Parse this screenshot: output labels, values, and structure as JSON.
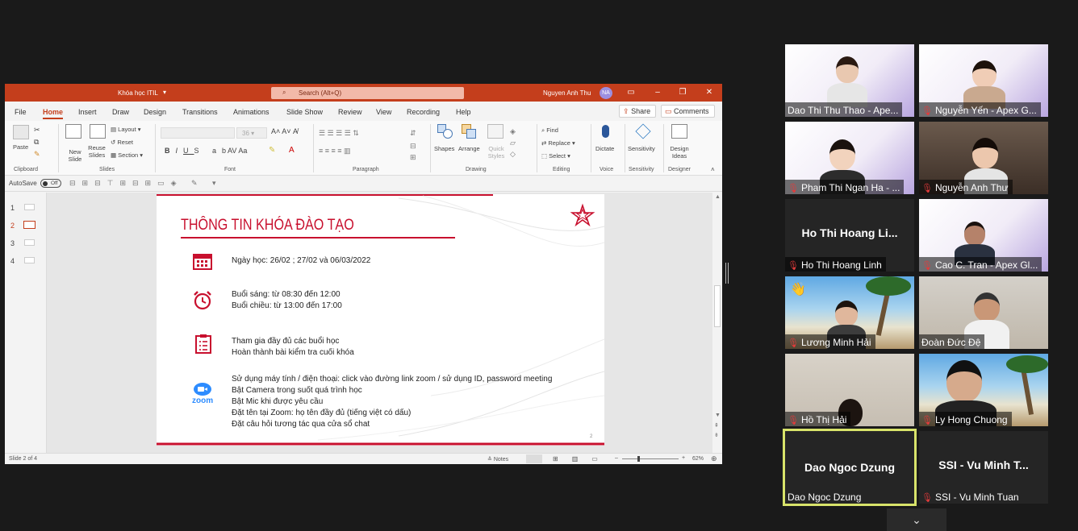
{
  "ppt": {
    "doc_title": "Khóa học ITIL",
    "search_placeholder": "Search (Alt+Q)",
    "user_name": "Nguyen Anh Thu",
    "user_initials": "NA",
    "menu": [
      "File",
      "Home",
      "Insert",
      "Draw",
      "Design",
      "Transitions",
      "Animations",
      "Slide Show",
      "Review",
      "View",
      "Recording",
      "Help"
    ],
    "share_label": "Share",
    "comments_label": "Comments",
    "ribbon": {
      "paste": "Paste",
      "clipboard": "Clipboard",
      "new_slide": "New Slide",
      "reuse_slides": "Reuse Slides",
      "layout": "Layout",
      "reset": "Reset",
      "section": "Section",
      "slides": "Slides",
      "font_size": "36",
      "font": "Font",
      "paragraph": "Paragraph",
      "shapes": "Shapes",
      "arrange": "Arrange",
      "quick_styles": "Quick Styles",
      "drawing": "Drawing",
      "find": "Find",
      "replace": "Replace",
      "select": "Select",
      "editing": "Editing",
      "dictate": "Dictate",
      "voice": "Voice",
      "sensitivity": "Sensitivity",
      "design_ideas": "Design Ideas",
      "designer": "Designer"
    },
    "autosave_label": "AutoSave",
    "autosave_state": "Off",
    "thumb_numbers": [
      "1",
      "2",
      "3",
      "4"
    ],
    "status_slide": "Slide 2 of 4",
    "notes_label": "Notes",
    "zoom_level": "62%"
  },
  "slide": {
    "title": "THÔNG TIN KHÓA ĐÀO TẠO",
    "date_line": "Ngày học: 26/02 ; 27/02 và 06/03/2022",
    "time_lines": [
      "Buổi sáng: từ 08:30 đến 12:00",
      "Buổi chiều: từ 13:00 đến 17:00"
    ],
    "task_lines": [
      "Tham gia đầy đủ các buổi học",
      "Hoàn thành bài kiểm tra cuối khóa"
    ],
    "zoom_lines": [
      "Sử dụng máy tính / điện thoại: click vào đường link zoom / sử dụng ID, password meeting",
      "Bật Camera trong suốt quá trình học",
      "Bật Mic khi được yêu cầu",
      "Đặt tên tại Zoom: họ tên đầy đủ (tiếng việt có dấu)",
      "Đặt câu hỏi tương tác qua cửa sổ chat"
    ],
    "zoom_logo_text": "zoom",
    "page_number": "2",
    "accent_color": "#c8102e"
  },
  "participants": [
    {
      "name": "Dao Thi Thu Thao - Ape...",
      "muted": false
    },
    {
      "name": "Nguyễn Yến - Apex G...",
      "muted": true
    },
    {
      "name": "Pham Thi Ngan Ha - ...",
      "muted": true
    },
    {
      "name": "Nguyễn Anh Thư",
      "muted": true
    },
    {
      "name": "Ho Thi Hoang Linh",
      "muted": true,
      "big": "Ho Thi Hoang Li..."
    },
    {
      "name": "Cao C. Tran - Apex Gl...",
      "muted": true
    },
    {
      "name": "Lương Minh Hải",
      "muted": true
    },
    {
      "name": "Đoàn Đức Đệ",
      "muted": false
    },
    {
      "name": "Hồ Thị Hải",
      "muted": true
    },
    {
      "name": "Ly Hong Chuong",
      "muted": true
    },
    {
      "name": "Dao Ngoc Dzung",
      "muted": false,
      "big": "Dao Ngoc Dzung"
    },
    {
      "name": "SSI - Vu Minh Tuan",
      "muted": true,
      "big": "SSI - Vu Minh T..."
    }
  ],
  "colors": {
    "ppt_brand": "#c43e1c",
    "active_speaker": "#d8e36a",
    "muted_icon": "#e23b3b"
  }
}
